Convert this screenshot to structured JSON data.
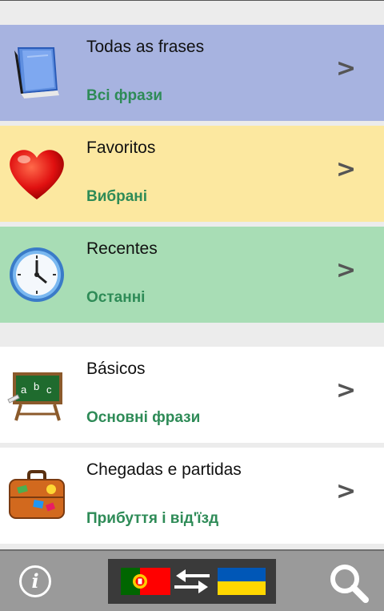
{
  "menu": {
    "items": [
      {
        "title": "Todas as frases",
        "subtitle": "Всі фрази",
        "icon": "book-icon",
        "bg": "#a7b3e0",
        "subtitle_color": "#2e8b57"
      },
      {
        "title": "Favoritos",
        "subtitle": "Вибрані",
        "icon": "heart-icon",
        "bg": "#fce8a0",
        "subtitle_color": "#2e8b57"
      },
      {
        "title": "Recentes",
        "subtitle": "Останні",
        "icon": "clock-icon",
        "bg": "#a8ddb5",
        "subtitle_color": "#2e8b57"
      },
      {
        "title": "Básicos",
        "subtitle": "Основні фрази",
        "icon": "chalkboard-icon",
        "bg": "#ffffff",
        "subtitle_color": "#2e8b57"
      },
      {
        "title": "Chegadas e partidas",
        "subtitle": "Прибуття і від'їзд",
        "icon": "suitcase-icon",
        "bg": "#ffffff",
        "subtitle_color": "#2e8b57"
      }
    ],
    "chevron": ">"
  },
  "bottom_bar": {
    "info_label": "i",
    "source_flag": "portugal-flag-icon",
    "swap": "swap-arrows-icon",
    "target_flag": "ukraine-flag-icon",
    "search": "search-icon"
  }
}
